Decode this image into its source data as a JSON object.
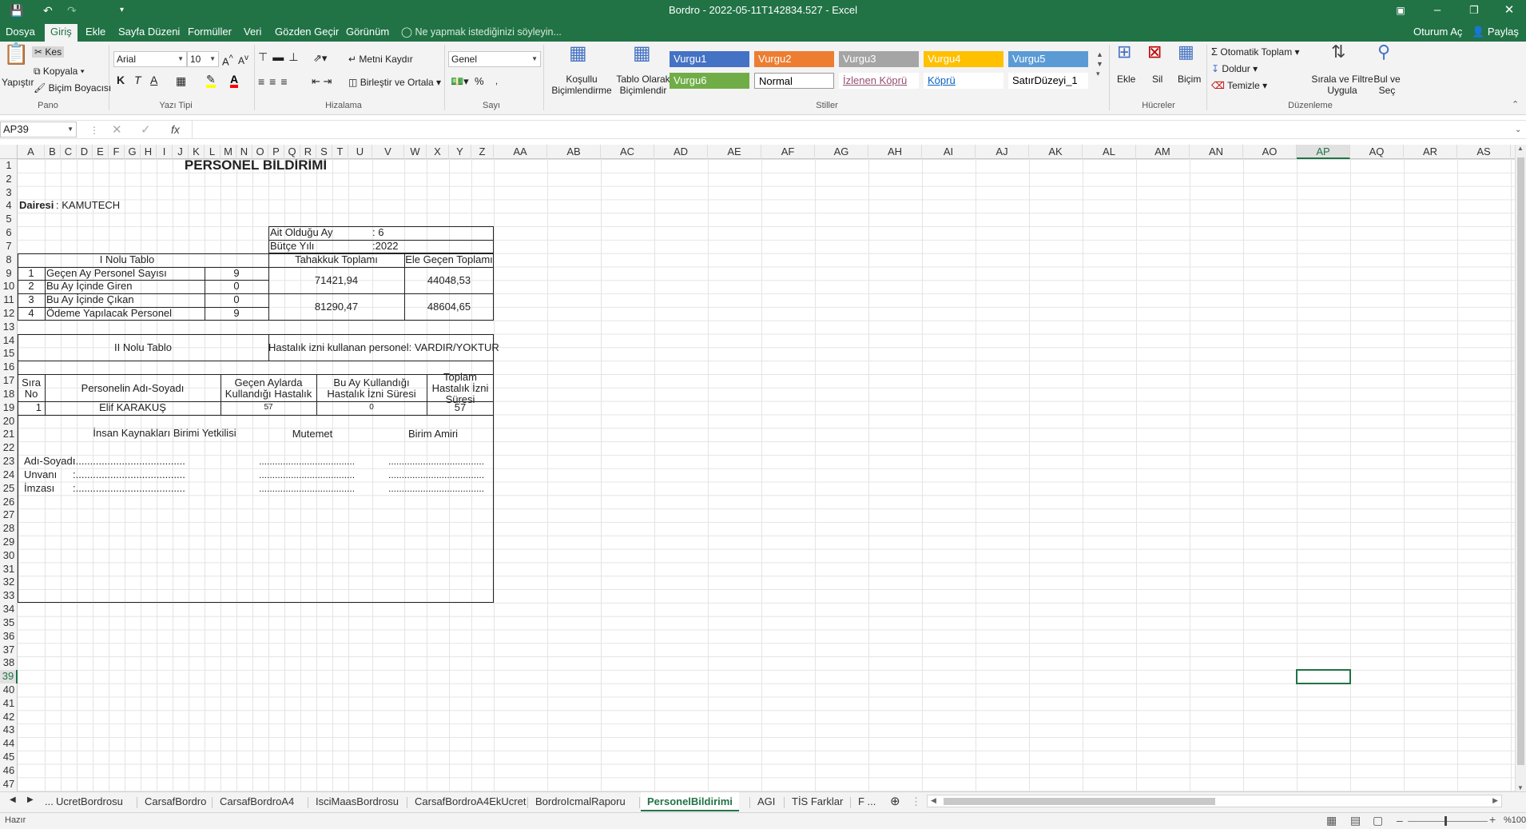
{
  "window": {
    "title": "Bordro - 2022-05-11T142834.527 - Excel",
    "icons": [
      "save-icon",
      "undo-icon",
      "redo-icon",
      "customize-qat-icon"
    ]
  },
  "menu": {
    "tabs": [
      "Dosya",
      "Giriş",
      "Ekle",
      "Sayfa Düzeni",
      "Formüller",
      "Veri",
      "Gözden Geçir",
      "Görünüm"
    ],
    "active_tab": "Giriş",
    "tellme": "Ne yapmak istediğinizi söyleyin...",
    "signin": "Oturum Aç",
    "share": "Paylaş"
  },
  "ribbon": {
    "clipboard": {
      "paste": "Yapıştır",
      "cut": "Kes",
      "copy": "Kopyala",
      "format_painter": "Biçim Boyacısı",
      "group": "Pano"
    },
    "font": {
      "name": "Arial",
      "size": "10",
      "bold": "K",
      "italic": "T",
      "underline": "A",
      "group": "Yazı Tipi",
      "accent_fill": "#ffff00",
      "accent_text": "#ff0000"
    },
    "alignment": {
      "wrap": "Metni Kaydır",
      "merge": "Birleştir ve Ortala",
      "group": "Hizalama"
    },
    "number": {
      "format": "Genel",
      "percent": "%",
      "comma": "000",
      "group": "Sayı"
    },
    "styles": {
      "conditional": "Koşullu Biçimlendirme",
      "as_table": "Tablo Olarak Biçimlendir",
      "group": "Stiller",
      "items": [
        {
          "label": "Vurgu1",
          "bg": "#4472c4",
          "fg": "#ffffff"
        },
        {
          "label": "Vurgu2",
          "bg": "#ed7d31",
          "fg": "#ffffff"
        },
        {
          "label": "Vurgu3",
          "bg": "#a5a5a5",
          "fg": "#ffffff"
        },
        {
          "label": "Vurgu4",
          "bg": "#ffc000",
          "fg": "#ffffff"
        },
        {
          "label": "Vurgu5",
          "bg": "#5b9bd5",
          "fg": "#ffffff"
        },
        {
          "label": "Vurgu6",
          "bg": "#70ad47",
          "fg": "#ffffff"
        },
        {
          "label": "Normal",
          "bg": "#ffffff",
          "fg": "#000000"
        },
        {
          "label": "İzlenen Köprü",
          "bg": "#ffffff",
          "fg": "#954f72"
        },
        {
          "label": "Köprü",
          "bg": "#ffffff",
          "fg": "#0563c1"
        },
        {
          "label": "SatırDüzeyi_1",
          "bg": "#ffffff",
          "fg": "#000000"
        }
      ]
    },
    "cells": {
      "insert": "Ekle",
      "delete": "Sil",
      "format": "Biçim",
      "group": "Hücreler"
    },
    "editing": {
      "autosum": "Otomatik Toplam",
      "fill": "Doldur",
      "clear": "Temizle",
      "sort": "Sırala ve Filtre Uygula",
      "find": "Bul ve Seç",
      "group": "Düzenleme"
    }
  },
  "formula_bar": {
    "name_box": "AP39",
    "fx": "fx",
    "cancel": "✕",
    "enter": "✓",
    "value": ""
  },
  "columns": [
    "A",
    "B",
    "C",
    "D",
    "E",
    "F",
    "G",
    "H",
    "I",
    "J",
    "K",
    "L",
    "M",
    "N",
    "O",
    "P",
    "Q",
    "R",
    "S",
    "T",
    "U",
    "V",
    "W",
    "X",
    "Y",
    "Z",
    "AA",
    "AB",
    "AC",
    "AD",
    "AE",
    "AF",
    "AG",
    "AH",
    "AI",
    "AJ",
    "AK",
    "AL",
    "AM",
    "AN",
    "AO",
    "AP",
    "AQ",
    "AR",
    "AS"
  ],
  "selected_column": "AP",
  "selected_row": "39",
  "rows": [
    "1",
    "2",
    "3",
    "4",
    "5",
    "6",
    "7",
    "8",
    "9",
    "10",
    "11",
    "12",
    "13",
    "14",
    "15",
    "16",
    "17",
    "18",
    "19",
    "20",
    "21",
    "22",
    "23",
    "24",
    "25",
    "26",
    "27",
    "28",
    "29",
    "30",
    "31",
    "32",
    "33",
    "34",
    "35",
    "36",
    "37",
    "38",
    "39",
    "40",
    "41",
    "42",
    "43",
    "44",
    "45",
    "46",
    "47"
  ],
  "sheet": {
    "title": "PERSONEL BİLDİRİMİ",
    "dairesi_label": "Dairesi",
    "dairesi_value": ": KAMUTECH",
    "ait_label": "Ait Olduğu Ay",
    "ait_value": ": 6",
    "butce_label": "Bütçe Yılı",
    "butce_value": ":2022",
    "table1_title": "I Nolu Tablo",
    "table1_rows": [
      {
        "no": "1",
        "label": "Geçen Ay Personel Sayısı",
        "value": "9"
      },
      {
        "no": "2",
        "label": "Bu Ay İçinde Giren",
        "value": "0"
      },
      {
        "no": "3",
        "label": "Bu Ay İçinde Çıkan",
        "value": "0"
      },
      {
        "no": "4",
        "label": "Ödeme Yapılacak Personel",
        "value": "9"
      }
    ],
    "tahakkuk_label": "Tahakkuk Toplamı",
    "ele_label": "Ele Geçen Toplamı",
    "tahakkuk_1": "71421,94",
    "ele_1": "44048,53",
    "tahakkuk_2": "81290,47",
    "ele_2": "48604,65",
    "table2_title": "II Nolu Tablo",
    "hastalik_note": "Hastalık izni kullanan personel: VARDIR/YOKTUR",
    "t2_headers": [
      "Sıra No",
      "Personelin Adı-Soyadı",
      "Geçen Aylarda Kullandığı Hastalık",
      "Bu Ay Kullandığı Hastalık İzni Süresi",
      "Toplam Hastalık İzni Süresi"
    ],
    "t2_row": {
      "no": "1",
      "name": "Elif KARAKUŞ",
      "gecen": "57",
      "bu_ay": "0",
      "toplam": "57"
    },
    "sig_hr": "İnsan Kaynakları Birimi Yetkilisi",
    "sig_mutemet": "Mutemet",
    "sig_amir": "Birim Amiri",
    "sig_labels": [
      "Adı-Soyadı",
      "Unvanı",
      "İmzası"
    ],
    "sig_dots": ":......................................",
    "sig_dots2": "...................................."
  },
  "sheet_tabs": [
    "UcretBordrosu",
    "CarsafBordro",
    "CarsafBordroA4",
    "IsciMaasBordrosu",
    "CarsafBordroA4EkUcret",
    "BordroIcmalRaporu",
    "PersonelBildirimi",
    "AGI",
    "TİS Farklar",
    "F ..."
  ],
  "active_sheet": "PersonelBildirimi",
  "status": {
    "ready": "Hazır",
    "zoom": "%100"
  }
}
